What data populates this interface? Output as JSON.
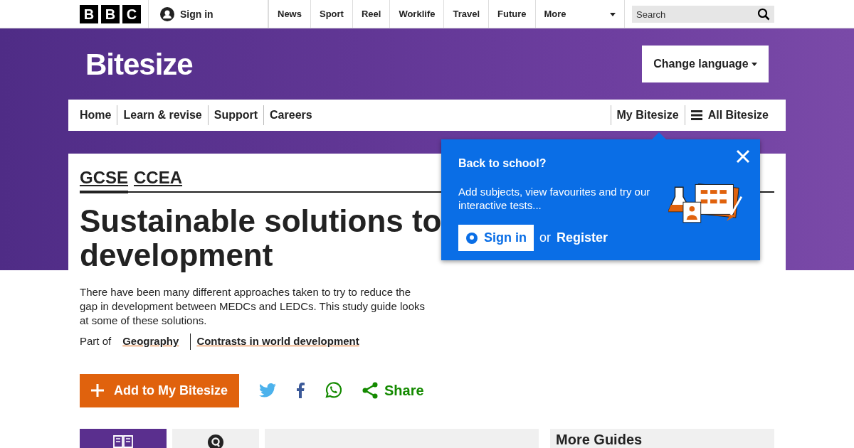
{
  "topbar": {
    "logo_letters": [
      "B",
      "B",
      "C"
    ],
    "sign_in": "Sign in",
    "nav": [
      "News",
      "Sport",
      "Reel",
      "Worklife",
      "Travel",
      "Future",
      "More"
    ],
    "search": {
      "placeholder": "Search"
    }
  },
  "header": {
    "title": "Bitesize",
    "change_language": "Change language"
  },
  "site_nav": {
    "left": [
      "Home",
      "Learn & revise",
      "Support",
      "Careers"
    ],
    "right": [
      "My Bitesize",
      "All Bitesize"
    ]
  },
  "popup": {
    "heading": "Back to school?",
    "text": "Add subjects, view favourites and try our interactive tests...",
    "sign_in": "Sign in",
    "or": "or",
    "register": "Register"
  },
  "article": {
    "levels": [
      {
        "label": "GCSE",
        "selected": true
      },
      {
        "label": "CCEA",
        "selected": false
      }
    ],
    "title_lines": [
      "Sustainable solutions to",
      "development"
    ],
    "summary": "There have been many different approaches taken to try to reduce the gap in development between MEDCs and LEDCs. This study guide looks at some of these solutions.",
    "part_of": "Part of",
    "links": [
      "Geography",
      "Contrasts in world development"
    ],
    "add_button": "Add to My Bitesize",
    "share": "Share"
  },
  "bottom": {
    "tabs": [
      {
        "kind": "read",
        "selected": true
      },
      {
        "kind": "quiz",
        "selected": false
      }
    ],
    "more_guides": "More Guides"
  }
}
